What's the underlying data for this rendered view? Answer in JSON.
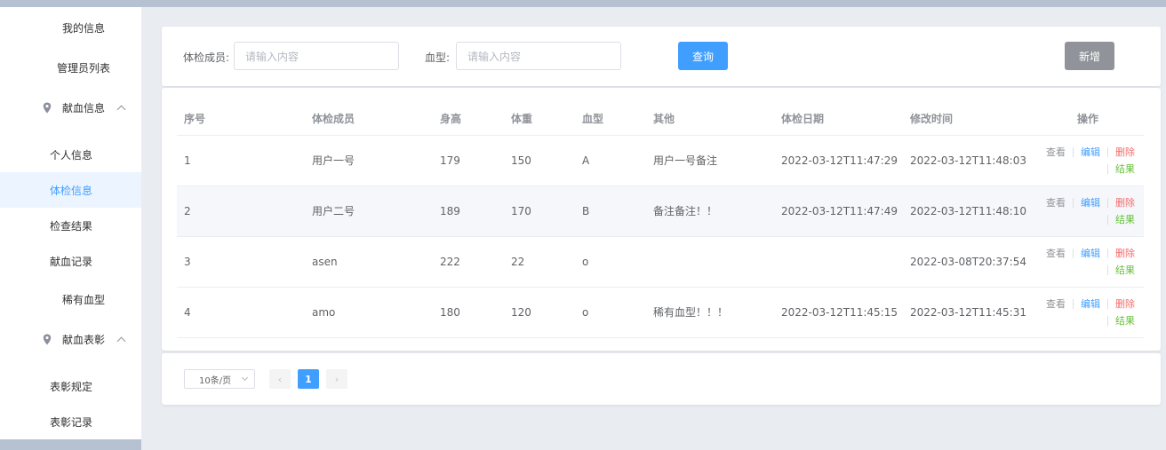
{
  "sidebar": {
    "items": [
      {
        "label": "我的信息",
        "icon": "grid-icon"
      },
      {
        "label": "管理员列表",
        "icon": "grid-icon"
      },
      {
        "label": "献血信息",
        "icon": "location-pin-icon",
        "expanded": true,
        "children": [
          "个人信息",
          "体检信息",
          "检查结果",
          "献血记录"
        ],
        "active_child": "体检信息"
      },
      {
        "label": "稀有血型",
        "icon": "grid-icon"
      },
      {
        "label": "献血表彰",
        "icon": "location-pin-icon",
        "expanded": true,
        "children": [
          "表彰规定",
          "表彰记录"
        ]
      }
    ]
  },
  "search": {
    "member_label": "体检成员:",
    "member_placeholder": "请输入内容",
    "blood_label": "血型:",
    "blood_placeholder": "请输入内容",
    "query_button": "查询",
    "add_button": "新增"
  },
  "table": {
    "columns": [
      "序号",
      "体检成员",
      "身高",
      "体重",
      "血型",
      "其他",
      "体检日期",
      "修改时间",
      "操作"
    ],
    "rows": [
      {
        "index": "1",
        "member": "用户一号",
        "height": "179",
        "weight": "150",
        "blood": "A",
        "other": "用户一号备注",
        "check_date": "2022-03-12T11:47:29",
        "modified": "2022-03-12T11:48:03"
      },
      {
        "index": "2",
        "member": "用户二号",
        "height": "189",
        "weight": "170",
        "blood": "B",
        "other": "备注备注！！",
        "check_date": "2022-03-12T11:47:49",
        "modified": "2022-03-12T11:48:10"
      },
      {
        "index": "3",
        "member": "asen",
        "height": "222",
        "weight": "22",
        "blood": "o",
        "other": "",
        "check_date": "",
        "modified": "2022-03-08T20:37:54"
      },
      {
        "index": "4",
        "member": "amo",
        "height": "180",
        "weight": "120",
        "blood": "o",
        "other": "稀有血型！！！",
        "check_date": "2022-03-12T11:45:15",
        "modified": "2022-03-12T11:45:31"
      }
    ],
    "actions": {
      "view": "查看",
      "edit": "编辑",
      "delete": "删除",
      "result": "结果"
    }
  },
  "pagination": {
    "page_size": "10条/页",
    "current_page": "1",
    "prev_icon": "chevron-left-icon",
    "next_icon": "chevron-right-icon"
  },
  "colors": {
    "primary": "#409eff",
    "danger": "#f56c6c",
    "success": "#67c23a",
    "info": "#909399"
  }
}
